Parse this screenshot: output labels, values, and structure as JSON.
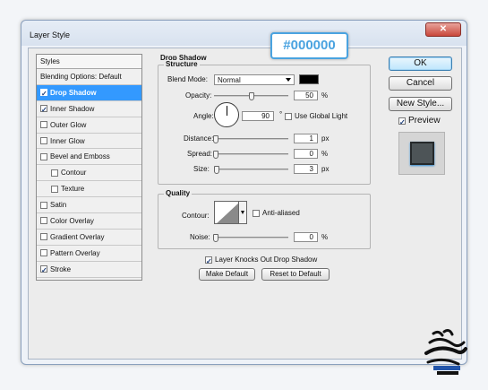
{
  "window": {
    "title": "Layer Style",
    "close_glyph": "✕"
  },
  "styles_panel": {
    "header": "Styles",
    "items": [
      {
        "label": "Blending Options: Default",
        "checkbox": false,
        "checked": false,
        "bold": false,
        "selected": false,
        "sub": false
      },
      {
        "label": "Drop Shadow",
        "checkbox": true,
        "checked": true,
        "bold": true,
        "selected": true,
        "sub": false
      },
      {
        "label": "Inner Shadow",
        "checkbox": true,
        "checked": true,
        "bold": false,
        "selected": false,
        "sub": false
      },
      {
        "label": "Outer Glow",
        "checkbox": true,
        "checked": false,
        "bold": false,
        "selected": false,
        "sub": false
      },
      {
        "label": "Inner Glow",
        "checkbox": true,
        "checked": false,
        "bold": false,
        "selected": false,
        "sub": false
      },
      {
        "label": "Bevel and Emboss",
        "checkbox": true,
        "checked": false,
        "bold": false,
        "selected": false,
        "sub": false
      },
      {
        "label": "Contour",
        "checkbox": true,
        "checked": false,
        "bold": false,
        "selected": false,
        "sub": true
      },
      {
        "label": "Texture",
        "checkbox": true,
        "checked": false,
        "bold": false,
        "selected": false,
        "sub": true
      },
      {
        "label": "Satin",
        "checkbox": true,
        "checked": false,
        "bold": false,
        "selected": false,
        "sub": false
      },
      {
        "label": "Color Overlay",
        "checkbox": true,
        "checked": false,
        "bold": false,
        "selected": false,
        "sub": false
      },
      {
        "label": "Gradient Overlay",
        "checkbox": true,
        "checked": false,
        "bold": false,
        "selected": false,
        "sub": false
      },
      {
        "label": "Pattern Overlay",
        "checkbox": true,
        "checked": false,
        "bold": false,
        "selected": false,
        "sub": false
      },
      {
        "label": "Stroke",
        "checkbox": true,
        "checked": true,
        "bold": false,
        "selected": false,
        "sub": false
      }
    ]
  },
  "drop_shadow": {
    "title": "Drop Shadow",
    "structure": {
      "title": "Structure",
      "blend_mode_label": "Blend Mode:",
      "blend_mode_value": "Normal",
      "shadow_color": "#000000",
      "opacity_label": "Opacity:",
      "opacity_value": "50",
      "opacity_unit": "%",
      "opacity_level": 0.5,
      "angle_label": "Angle:",
      "angle_value": "90",
      "angle_unit": "°",
      "use_global_light_label": "Use Global Light",
      "use_global_light_checked": false,
      "distance_label": "Distance:",
      "distance_value": "1",
      "distance_unit": "px",
      "spread_label": "Spread:",
      "spread_value": "0",
      "spread_unit": "%",
      "size_label": "Size:",
      "size_value": "3",
      "size_unit": "px"
    },
    "quality": {
      "title": "Quality",
      "contour_label": "Contour:",
      "anti_aliased_label": "Anti-aliased",
      "anti_aliased_checked": false,
      "noise_label": "Noise:",
      "noise_value": "0",
      "noise_unit": "%"
    },
    "knockout_label": "Layer Knocks Out Drop Shadow",
    "knockout_checked": true,
    "make_default_label": "Make Default",
    "reset_default_label": "Reset to Default"
  },
  "buttons": {
    "ok": "OK",
    "cancel": "Cancel",
    "new_style": "New Style...",
    "preview_label": "Preview",
    "preview_checked": true
  },
  "annotation": {
    "hex_prefix": "#",
    "hex_value": "000000"
  },
  "colors": {
    "selection": "#3399ff",
    "badge": "#4aa3e0",
    "preview_swatch": "#4d5457"
  }
}
